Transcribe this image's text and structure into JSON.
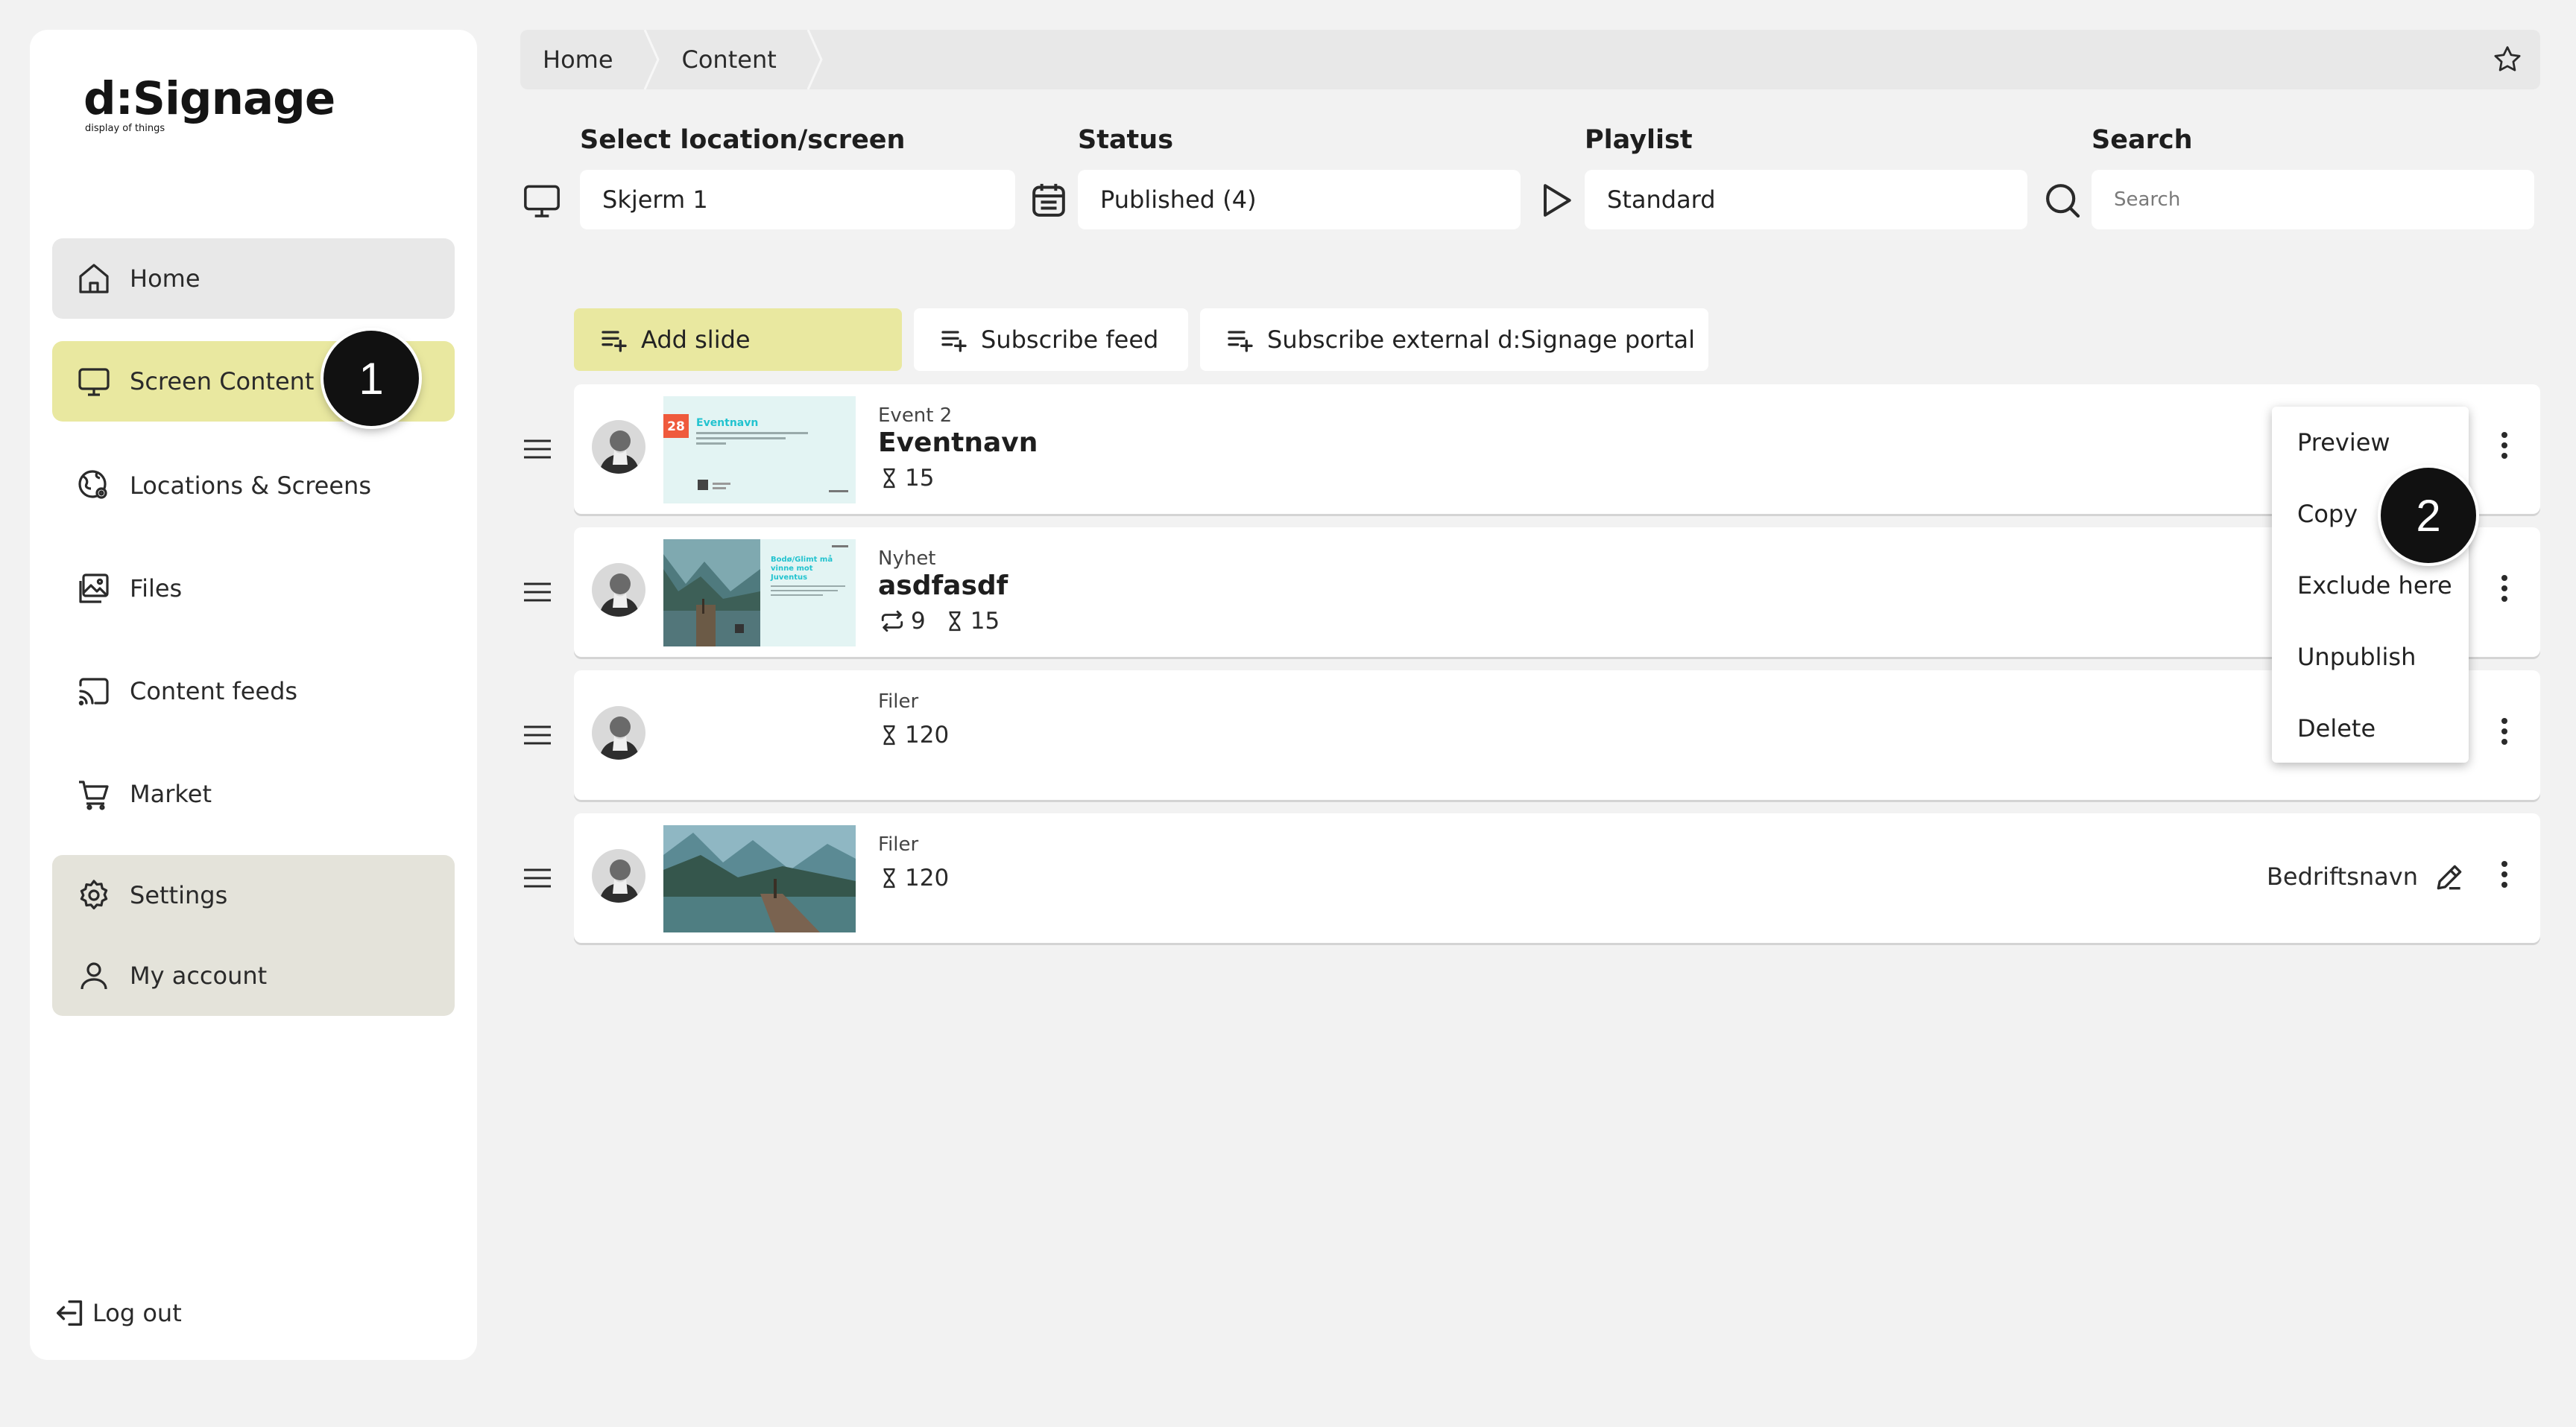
{
  "brand": {
    "name": "d:Signage",
    "tagline": "display of things"
  },
  "sidebar": {
    "items": [
      {
        "label": "Home",
        "icon": "home-icon"
      },
      {
        "label": "Screen Content",
        "icon": "monitor-icon"
      },
      {
        "label": "Locations & Screens",
        "icon": "location-icon"
      },
      {
        "label": "Files",
        "icon": "image-icon"
      },
      {
        "label": "Content feeds",
        "icon": "cast-icon"
      },
      {
        "label": "Market",
        "icon": "cart-icon"
      }
    ],
    "settings": {
      "label": "Settings",
      "icon": "gear-icon"
    },
    "account": {
      "label": "My account",
      "icon": "user-icon"
    },
    "logout": {
      "label": "Log out",
      "icon": "logout-icon"
    }
  },
  "breadcrumb": {
    "home": "Home",
    "content": "Content"
  },
  "filters": {
    "location": {
      "label": "Select location/screen",
      "value": "Skjerm 1"
    },
    "status": {
      "label": "Status",
      "value": "Published (4)"
    },
    "playlist": {
      "label": "Playlist",
      "value": "Standard"
    },
    "search": {
      "label": "Search",
      "placeholder": "Search"
    }
  },
  "actions": {
    "add_slide": "Add slide",
    "subscribe_feed": "Subscribe feed",
    "subscribe_external": "Subscribe external d:Signage portal"
  },
  "slides": [
    {
      "category": "Event 2",
      "title": "Eventnavn",
      "duration": "15",
      "thumb_date": "28",
      "thumb_title": "Eventnavn"
    },
    {
      "category": "Nyhet",
      "title": "asdfasdf",
      "repeat": "9",
      "duration": "15",
      "thumb_title": "Bodø/Glimt må vinne mot Juventus"
    },
    {
      "category": "Filer",
      "title": "",
      "duration": "120"
    },
    {
      "category": "Filer",
      "title": "",
      "duration": "120",
      "owner": "Bedriftsnavn"
    }
  ],
  "context_menu": {
    "items": [
      "Preview",
      "Copy",
      "Exclude here",
      "Unpublish",
      "Delete"
    ]
  },
  "step_badges": [
    "1",
    "2"
  ],
  "colors": {
    "accent": "#e9e8a0",
    "settings_bg": "#e4e3da",
    "page_bg": "#f2f2f2"
  }
}
